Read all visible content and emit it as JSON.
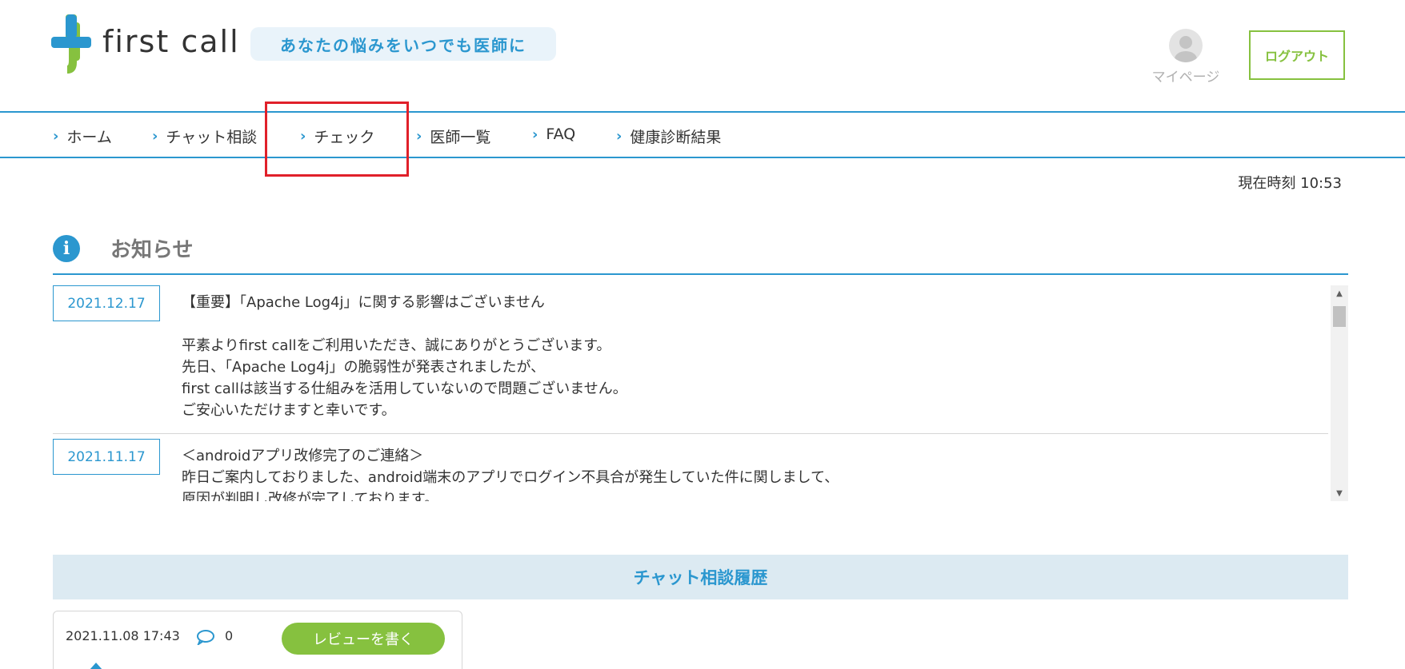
{
  "header": {
    "logo_text": "first call",
    "tagline": "あなたの悩みをいつでも医師に",
    "mypage_label": "マイページ",
    "logout_label": "ログアウト"
  },
  "nav": {
    "items": [
      {
        "label": "ホーム"
      },
      {
        "label": "チャット相談"
      },
      {
        "label": "チェック"
      },
      {
        "label": "医師一覧"
      },
      {
        "label": "FAQ"
      },
      {
        "label": "健康診断結果"
      }
    ]
  },
  "clock": "現在時刻 10:53",
  "news": {
    "title": "お知らせ",
    "entries": [
      {
        "date": "2021.12.17",
        "lines": [
          "【重要】「Apache Log4j」に関する影響はございません",
          "",
          "平素よりfirst callをご利用いただき、誠にありがとうございます。",
          "先日、「Apache Log4j」の脆弱性が発表されましたが、",
          "first callは該当する仕組みを活用していないので問題ございません。",
          "ご安心いただけますと幸いです。"
        ]
      },
      {
        "date": "2021.11.17",
        "lines": [
          "＜androidアプリ改修完了のご連絡＞",
          "昨日ご案内しておりました、android端末のアプリでログイン不具合が発生していた件に関しまして、",
          "原因が判明し改修が完了しております。"
        ]
      }
    ]
  },
  "chat_history": {
    "title": "チャット相談履歴",
    "card": {
      "datetime": "2021.11.08 17:43",
      "comment_count": "0",
      "review_label": "レビューを書く"
    }
  },
  "colors": {
    "brand_blue": "#2b97cf",
    "brand_green": "#86c13f",
    "highlight_red": "#e0202a"
  }
}
